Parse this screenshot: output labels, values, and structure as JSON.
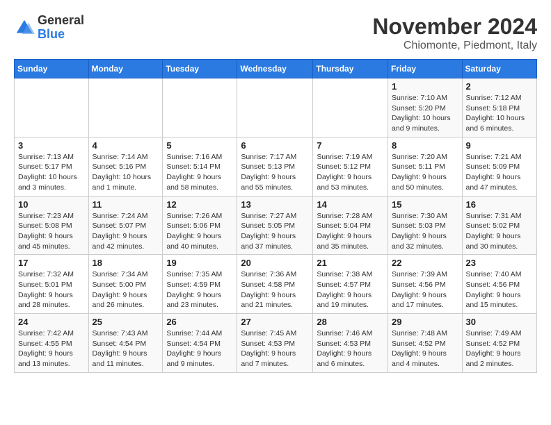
{
  "logo": {
    "general": "General",
    "blue": "Blue"
  },
  "title": "November 2024",
  "location": "Chiomonte, Piedmont, Italy",
  "days_of_week": [
    "Sunday",
    "Monday",
    "Tuesday",
    "Wednesday",
    "Thursday",
    "Friday",
    "Saturday"
  ],
  "weeks": [
    [
      {
        "day": "",
        "info": ""
      },
      {
        "day": "",
        "info": ""
      },
      {
        "day": "",
        "info": ""
      },
      {
        "day": "",
        "info": ""
      },
      {
        "day": "",
        "info": ""
      },
      {
        "day": "1",
        "info": "Sunrise: 7:10 AM\nSunset: 5:20 PM\nDaylight: 10 hours\nand 9 minutes."
      },
      {
        "day": "2",
        "info": "Sunrise: 7:12 AM\nSunset: 5:18 PM\nDaylight: 10 hours\nand 6 minutes."
      }
    ],
    [
      {
        "day": "3",
        "info": "Sunrise: 7:13 AM\nSunset: 5:17 PM\nDaylight: 10 hours\nand 3 minutes."
      },
      {
        "day": "4",
        "info": "Sunrise: 7:14 AM\nSunset: 5:16 PM\nDaylight: 10 hours\nand 1 minute."
      },
      {
        "day": "5",
        "info": "Sunrise: 7:16 AM\nSunset: 5:14 PM\nDaylight: 9 hours\nand 58 minutes."
      },
      {
        "day": "6",
        "info": "Sunrise: 7:17 AM\nSunset: 5:13 PM\nDaylight: 9 hours\nand 55 minutes."
      },
      {
        "day": "7",
        "info": "Sunrise: 7:19 AM\nSunset: 5:12 PM\nDaylight: 9 hours\nand 53 minutes."
      },
      {
        "day": "8",
        "info": "Sunrise: 7:20 AM\nSunset: 5:11 PM\nDaylight: 9 hours\nand 50 minutes."
      },
      {
        "day": "9",
        "info": "Sunrise: 7:21 AM\nSunset: 5:09 PM\nDaylight: 9 hours\nand 47 minutes."
      }
    ],
    [
      {
        "day": "10",
        "info": "Sunrise: 7:23 AM\nSunset: 5:08 PM\nDaylight: 9 hours\nand 45 minutes."
      },
      {
        "day": "11",
        "info": "Sunrise: 7:24 AM\nSunset: 5:07 PM\nDaylight: 9 hours\nand 42 minutes."
      },
      {
        "day": "12",
        "info": "Sunrise: 7:26 AM\nSunset: 5:06 PM\nDaylight: 9 hours\nand 40 minutes."
      },
      {
        "day": "13",
        "info": "Sunrise: 7:27 AM\nSunset: 5:05 PM\nDaylight: 9 hours\nand 37 minutes."
      },
      {
        "day": "14",
        "info": "Sunrise: 7:28 AM\nSunset: 5:04 PM\nDaylight: 9 hours\nand 35 minutes."
      },
      {
        "day": "15",
        "info": "Sunrise: 7:30 AM\nSunset: 5:03 PM\nDaylight: 9 hours\nand 32 minutes."
      },
      {
        "day": "16",
        "info": "Sunrise: 7:31 AM\nSunset: 5:02 PM\nDaylight: 9 hours\nand 30 minutes."
      }
    ],
    [
      {
        "day": "17",
        "info": "Sunrise: 7:32 AM\nSunset: 5:01 PM\nDaylight: 9 hours\nand 28 minutes."
      },
      {
        "day": "18",
        "info": "Sunrise: 7:34 AM\nSunset: 5:00 PM\nDaylight: 9 hours\nand 26 minutes."
      },
      {
        "day": "19",
        "info": "Sunrise: 7:35 AM\nSunset: 4:59 PM\nDaylight: 9 hours\nand 23 minutes."
      },
      {
        "day": "20",
        "info": "Sunrise: 7:36 AM\nSunset: 4:58 PM\nDaylight: 9 hours\nand 21 minutes."
      },
      {
        "day": "21",
        "info": "Sunrise: 7:38 AM\nSunset: 4:57 PM\nDaylight: 9 hours\nand 19 minutes."
      },
      {
        "day": "22",
        "info": "Sunrise: 7:39 AM\nSunset: 4:56 PM\nDaylight: 9 hours\nand 17 minutes."
      },
      {
        "day": "23",
        "info": "Sunrise: 7:40 AM\nSunset: 4:56 PM\nDaylight: 9 hours\nand 15 minutes."
      }
    ],
    [
      {
        "day": "24",
        "info": "Sunrise: 7:42 AM\nSunset: 4:55 PM\nDaylight: 9 hours\nand 13 minutes."
      },
      {
        "day": "25",
        "info": "Sunrise: 7:43 AM\nSunset: 4:54 PM\nDaylight: 9 hours\nand 11 minutes."
      },
      {
        "day": "26",
        "info": "Sunrise: 7:44 AM\nSunset: 4:54 PM\nDaylight: 9 hours\nand 9 minutes."
      },
      {
        "day": "27",
        "info": "Sunrise: 7:45 AM\nSunset: 4:53 PM\nDaylight: 9 hours\nand 7 minutes."
      },
      {
        "day": "28",
        "info": "Sunrise: 7:46 AM\nSunset: 4:53 PM\nDaylight: 9 hours\nand 6 minutes."
      },
      {
        "day": "29",
        "info": "Sunrise: 7:48 AM\nSunset: 4:52 PM\nDaylight: 9 hours\nand 4 minutes."
      },
      {
        "day": "30",
        "info": "Sunrise: 7:49 AM\nSunset: 4:52 PM\nDaylight: 9 hours\nand 2 minutes."
      }
    ]
  ]
}
